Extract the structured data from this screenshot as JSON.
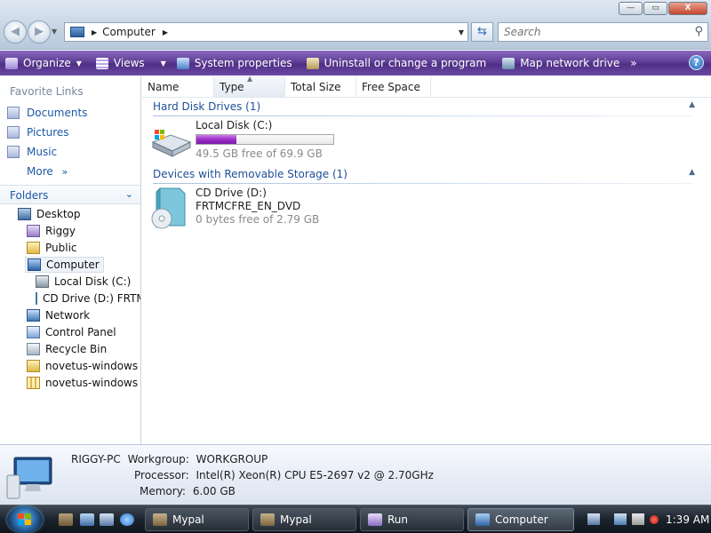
{
  "window": {
    "controls": {
      "minimize": "—",
      "maximize": "▭",
      "close": "X"
    }
  },
  "address_bar": {
    "crumb": "Computer",
    "search_placeholder": "Search"
  },
  "toolbar": {
    "items": [
      {
        "label": "Organize",
        "icon": "organize-icon",
        "has_dropdown": true
      },
      {
        "label": "Views",
        "icon": "views-icon",
        "has_dropdown": true
      },
      {
        "label": "System properties",
        "icon": "system-properties-icon"
      },
      {
        "label": "Uninstall or change a program",
        "icon": "uninstall-icon"
      },
      {
        "label": "Map network drive",
        "icon": "map-network-drive-icon"
      }
    ],
    "overflow": "»",
    "help": "?"
  },
  "favorite_links": {
    "header": "Favorite Links",
    "items": [
      "Documents",
      "Pictures",
      "Music"
    ],
    "more": "More"
  },
  "folders": {
    "header": "Folders",
    "tree": [
      {
        "label": "Desktop",
        "level": 0,
        "icon": "desktop-icon"
      },
      {
        "label": "Riggy",
        "level": 1,
        "icon": "user-folder-icon"
      },
      {
        "label": "Public",
        "level": 1,
        "icon": "folder-icon"
      },
      {
        "label": "Computer",
        "level": 1,
        "icon": "computer-icon",
        "selected": true
      },
      {
        "label": "Local Disk (C:)",
        "level": 2,
        "icon": "hard-disk-icon"
      },
      {
        "label": "CD Drive (D:) FRTM",
        "level": 2,
        "icon": "cd-drive-icon"
      },
      {
        "label": "Network",
        "level": 1,
        "icon": "network-icon"
      },
      {
        "label": "Control Panel",
        "level": 1,
        "icon": "control-panel-icon"
      },
      {
        "label": "Recycle Bin",
        "level": 1,
        "icon": "recycle-bin-icon"
      },
      {
        "label": "novetus-windows",
        "level": 1,
        "icon": "folder-icon"
      },
      {
        "label": "novetus-windows",
        "level": 1,
        "icon": "zip-folder-icon"
      }
    ]
  },
  "columns": [
    "Name",
    "Type",
    "Total Size",
    "Free Space"
  ],
  "groups": {
    "hard_disks": {
      "header": "Hard Disk Drives (1)",
      "drive": {
        "name": "Local Disk (C:)",
        "free_text": "49.5 GB free of 69.9 GB",
        "used_fraction": 0.29
      }
    },
    "removable": {
      "header": "Devices with Removable Storage (1)",
      "drive": {
        "name": "CD Drive (D:)",
        "label": "FRTMCFRE_EN_DVD",
        "free_text": "0 bytes free of 2.79 GB"
      }
    }
  },
  "details": {
    "computer_name": "RIGGY-PC",
    "workgroup_label": "Workgroup:",
    "workgroup": "WORKGROUP",
    "processor_label": "Processor:",
    "processor": "Intel(R) Xeon(R) CPU E5-2697 v2 @ 2.70GHz",
    "memory_label": "Memory:",
    "memory": "6.00 GB"
  },
  "taskbar": {
    "tasks": [
      {
        "label": "Mypal",
        "active": false
      },
      {
        "label": "Mypal",
        "active": false
      },
      {
        "label": "Run",
        "active": false
      },
      {
        "label": "Computer",
        "active": true
      }
    ],
    "clock": "1:39 AM"
  },
  "colors": {
    "toolbar_accent": "#5f3f96",
    "link_blue": "#1b58a8",
    "group_header": "#1e4f99",
    "disk_bar_fill": "#9b2fc7"
  }
}
